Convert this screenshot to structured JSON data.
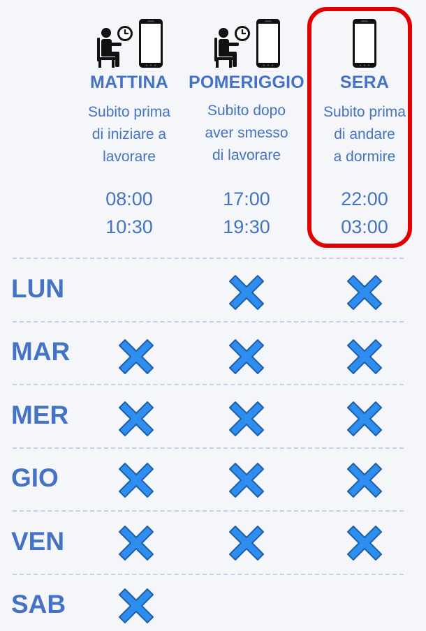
{
  "columns": [
    {
      "heading": "MATTINA",
      "description": [
        "Subito prima",
        "di iniziare a",
        "lavorare"
      ],
      "times": [
        "08:00",
        "10:30"
      ],
      "icons": [
        "person-seated-clock-icon",
        "smartphone-icon"
      ]
    },
    {
      "heading": "POMERIGGIO",
      "description": [
        "Subito dopo",
        "aver smesso",
        "di lavorare"
      ],
      "times": [
        "17:00",
        "19:30"
      ],
      "icons": [
        "person-seated-clock-icon",
        "smartphone-icon"
      ]
    },
    {
      "heading": "SERA",
      "description": [
        "Subito prima",
        "di andare",
        "a dormire"
      ],
      "times": [
        "22:00",
        "03:00"
      ],
      "icons": [
        "smartphone-icon"
      ],
      "highlighted": true
    }
  ],
  "days": [
    {
      "label": "LUN",
      "marks": [
        false,
        true,
        true
      ]
    },
    {
      "label": "MAR",
      "marks": [
        true,
        true,
        true
      ]
    },
    {
      "label": "MER",
      "marks": [
        true,
        true,
        true
      ]
    },
    {
      "label": "GIO",
      "marks": [
        true,
        true,
        true
      ]
    },
    {
      "label": "VEN",
      "marks": [
        true,
        true,
        true
      ]
    },
    {
      "label": "SAB",
      "marks": [
        true,
        false,
        false
      ]
    }
  ],
  "colors": {
    "text": "#4472c4",
    "mark_fill": "#2e8ef0",
    "mark_stroke": "#1f5fa8",
    "highlight_border": "#e00000",
    "divider": "#c4d1ec"
  }
}
